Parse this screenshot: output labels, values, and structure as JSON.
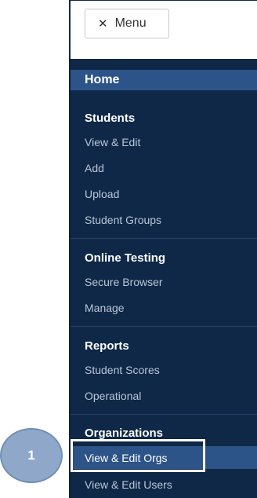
{
  "topbar": {
    "menu_label": "Menu",
    "menu_icon": "close-icon"
  },
  "sidebar": {
    "home": "Home",
    "sections": [
      {
        "heading": "Students",
        "links": [
          "View & Edit",
          "Add",
          "Upload",
          "Student Groups"
        ]
      },
      {
        "heading": "Online Testing",
        "links": [
          "Secure Browser",
          "Manage"
        ]
      },
      {
        "heading": "Reports",
        "links": [
          "Student Scores",
          "Operational"
        ]
      },
      {
        "heading": "Organizations",
        "links": [
          "View & Edit Orgs",
          "View & Edit Users"
        ]
      }
    ],
    "active_link": "View & Edit Orgs"
  },
  "annotation": {
    "step_number": "1"
  },
  "colors": {
    "sidebar_bg": "#0f2847",
    "active_bg": "#2d5488",
    "link_text": "#b9c6d8",
    "badge": "#8fa8c9"
  }
}
